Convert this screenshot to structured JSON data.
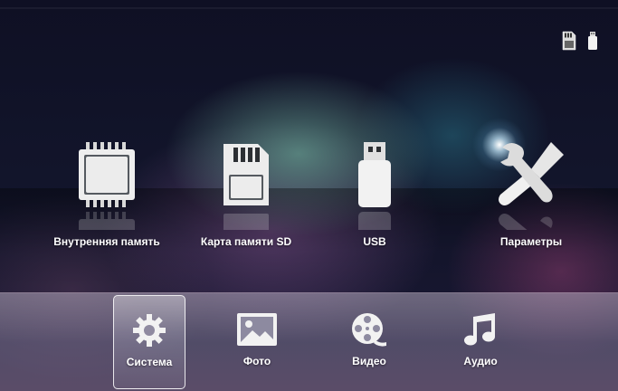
{
  "status_icons": [
    "sd-card-icon",
    "usb-drive-icon"
  ],
  "sources": [
    {
      "label": "Внутренняя память",
      "icon": "memory-chip-icon"
    },
    {
      "label": "Карта памяти SD",
      "icon": "sd-card-icon"
    },
    {
      "label": "USB",
      "icon": "usb-drive-icon"
    },
    {
      "label": "Параметры",
      "icon": "wrench-screwdriver-icon"
    }
  ],
  "tabs": [
    {
      "label": "Система",
      "icon": "gear-icon",
      "selected": true
    },
    {
      "label": "Фото",
      "icon": "photo-icon",
      "selected": false
    },
    {
      "label": "Видео",
      "icon": "film-reel-icon",
      "selected": false
    },
    {
      "label": "Аудио",
      "icon": "music-note-icon",
      "selected": false
    }
  ],
  "colors": {
    "icon_fill": "#e8e8e8",
    "label_text": "#ffffff"
  }
}
